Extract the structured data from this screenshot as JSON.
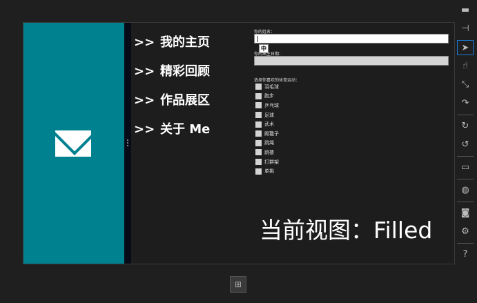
{
  "nav": {
    "prefix": ">>",
    "items": [
      "我的主页",
      "精彩回顾",
      "作品展区",
      "关于 Me"
    ]
  },
  "form": {
    "name_label": "你的姓名：",
    "ime_indicator": "中",
    "birth_label": "你的出生日期：",
    "sports_label": "选择你喜欢的体育运动：",
    "sports": [
      "羽毛球",
      "跑步",
      "乒乓球",
      "足球",
      "武术",
      "踢毽子",
      "跳绳",
      "跳楼",
      "打群架",
      "单挑"
    ]
  },
  "view_state": "当前视图：Filled",
  "colors": {
    "snap_bg": "#00818f",
    "accent": "#1a7ad8"
  }
}
